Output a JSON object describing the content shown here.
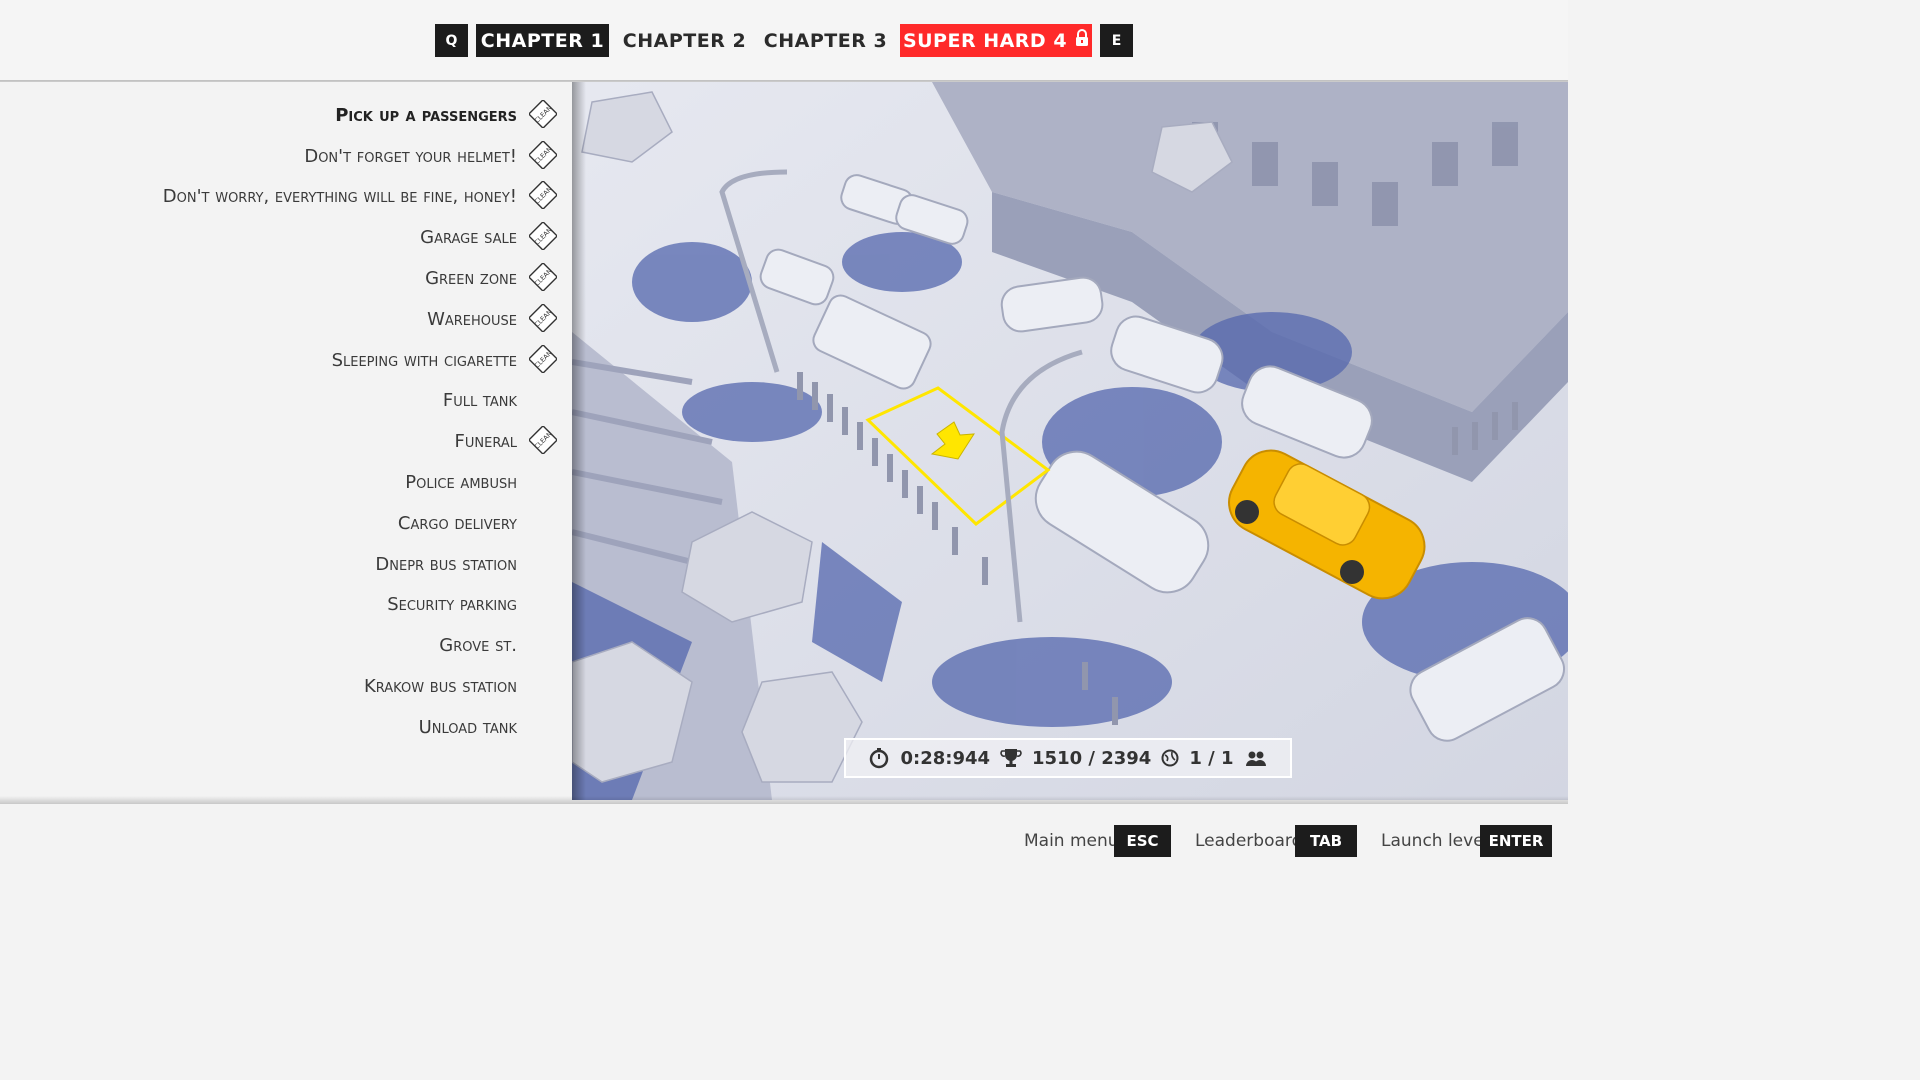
{
  "chapter_nav": {
    "prev_key": "Q",
    "next_key": "E",
    "tabs": [
      {
        "label": "CHAPTER 1",
        "state": "active"
      },
      {
        "label": "CHAPTER 2",
        "state": "normal"
      },
      {
        "label": "CHAPTER 3",
        "state": "normal"
      },
      {
        "label": "SUPER HARD 4",
        "state": "locked"
      }
    ]
  },
  "levels": [
    {
      "label": "Pick up a passengers",
      "badge": "CLEAN",
      "active": true
    },
    {
      "label": "Don't forget your helmet!",
      "badge": "CLEAN"
    },
    {
      "label": "Don't worry, everything will be fine, honey!",
      "badge": "CLEAN"
    },
    {
      "label": "Garage sale",
      "badge": "CLEAN"
    },
    {
      "label": "Green zone",
      "badge": "CLEAN"
    },
    {
      "label": "Warehouse",
      "badge": "CLEAN"
    },
    {
      "label": "Sleeping with cigarette",
      "badge": "CLEAN"
    },
    {
      "label": "Full tank",
      "badge": ""
    },
    {
      "label": "Funeral",
      "badge": "CLEAN"
    },
    {
      "label": "Police ambush",
      "badge": ""
    },
    {
      "label": "Cargo delivery",
      "badge": ""
    },
    {
      "label": "Dnepr bus station",
      "badge": ""
    },
    {
      "label": "Security parking",
      "badge": ""
    },
    {
      "label": "Grove st.",
      "badge": ""
    },
    {
      "label": "Krakow bus station",
      "badge": ""
    },
    {
      "label": "Unload tank",
      "badge": ""
    }
  ],
  "hud": {
    "time": "0:28:944",
    "score": "1510 / 2394",
    "passengers": "1 / 1"
  },
  "hints": {
    "main_menu_label": "Main menu",
    "main_menu_key": "ESC",
    "leaderboard_label": "Leaderboard",
    "leaderboard_key": "TAB",
    "launch_label": "Launch level",
    "launch_key": "ENTER"
  },
  "colors": {
    "accent_locked": "#ff2a2a",
    "taxi": "#f5b400",
    "target_zone": "#ffe600",
    "dark_key": "#1c1c1c"
  }
}
